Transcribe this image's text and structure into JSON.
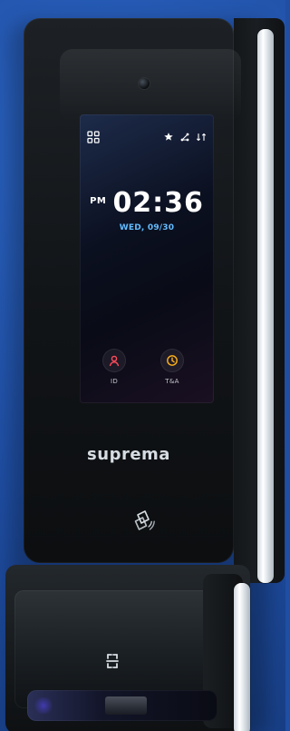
{
  "device": {
    "brand_text": "suprema"
  },
  "screen": {
    "ampm": "PM",
    "time": "02:36",
    "date": "WED, 09/30",
    "buttons": [
      {
        "label": "ID",
        "icon": "person-icon"
      },
      {
        "label": "T&A",
        "icon": "clock-icon"
      }
    ]
  },
  "colors": {
    "background": "#1f4ea3",
    "date_text": "#63bcff",
    "id_icon": "#ff4b5b",
    "tna_icon": "#ffb21a"
  }
}
